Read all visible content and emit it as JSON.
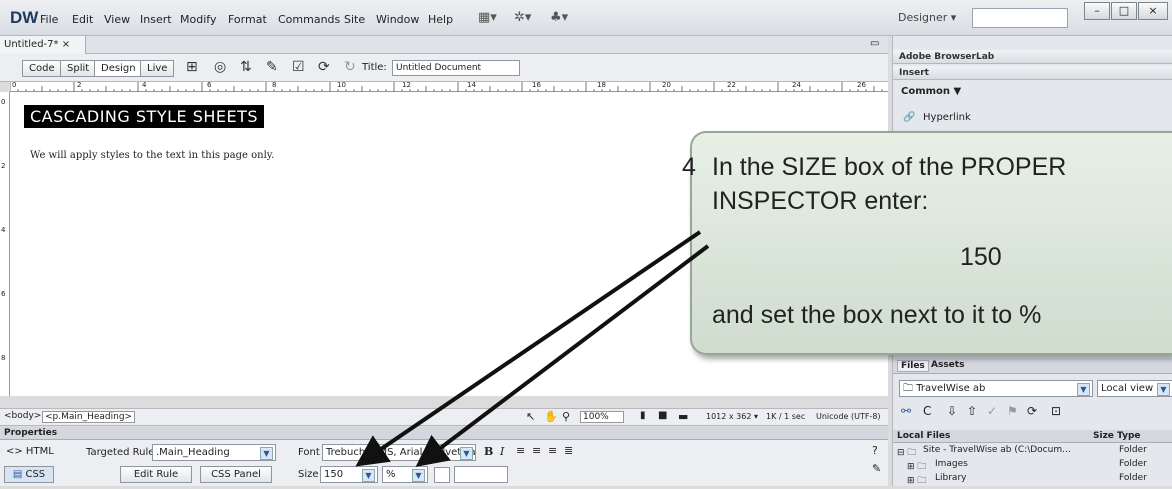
{
  "app": {
    "logo": "DW",
    "designer": "Designer"
  },
  "menu": [
    "File",
    "Edit",
    "View",
    "Insert",
    "Modify",
    "Format",
    "Commands",
    "Site",
    "Window",
    "Help"
  ],
  "window_buttons": [
    "–",
    "□",
    "×"
  ],
  "document": {
    "tab_label": "Untitled-7*",
    "view_buttons": [
      "Code",
      "Split",
      "Design",
      "Live"
    ],
    "title_label": "Title:",
    "title_value": "Untitled Document",
    "heading": "CASCADING STYLE SHEETS",
    "paragraph": "We will apply styles to the text in this page only."
  },
  "ruler_h": [
    "0",
    "2",
    "4",
    "6",
    "8",
    "10",
    "12",
    "14",
    "16",
    "18",
    "20",
    "22",
    "24",
    "26"
  ],
  "ruler_v": [
    "0",
    "2",
    "4",
    "6",
    "8"
  ],
  "status": {
    "tags": [
      "<body>",
      "<p.Main_Heading>"
    ],
    "zoom": "100%",
    "size": "1012 x 362",
    "weight": "1K / 1 sec",
    "encoding": "Unicode (UTF-8)"
  },
  "properties": {
    "header": "Properties",
    "html_tab": "<> HTML",
    "css_tab": "CSS",
    "targeted_rule_label": "Targeted Rule",
    "targeted_rule_value": ".Main_Heading",
    "edit_rule": "Edit Rule",
    "css_panel": "CSS Panel",
    "font_label": "Font",
    "font_value": "Trebuchet MS, Arial, Helvetica, sans",
    "size_label": "Size",
    "size_value": "150",
    "unit_value": "%"
  },
  "right_panel": {
    "browserlab": "Adobe BrowserLab",
    "insert": "Insert",
    "common": "Common ▼",
    "hyperlink": "Hyperlink",
    "files_tab": "Files",
    "assets_tab": "Assets",
    "site_select": "TravelWise ab",
    "view_select": "Local view",
    "columns": [
      "Local Files",
      "Size",
      "Type"
    ],
    "rows": [
      {
        "name": "Site - TravelWise ab (C:\\Docum...",
        "type": "Folder"
      },
      {
        "name": "Images",
        "type": "Folder"
      },
      {
        "name": "Library",
        "type": "Folder"
      }
    ]
  },
  "callout": {
    "step": "4",
    "line1": "In the SIZE box of the PROPER",
    "line2": "INSPECTOR enter:",
    "value": "150",
    "line3": "and set the box next to it to %"
  }
}
